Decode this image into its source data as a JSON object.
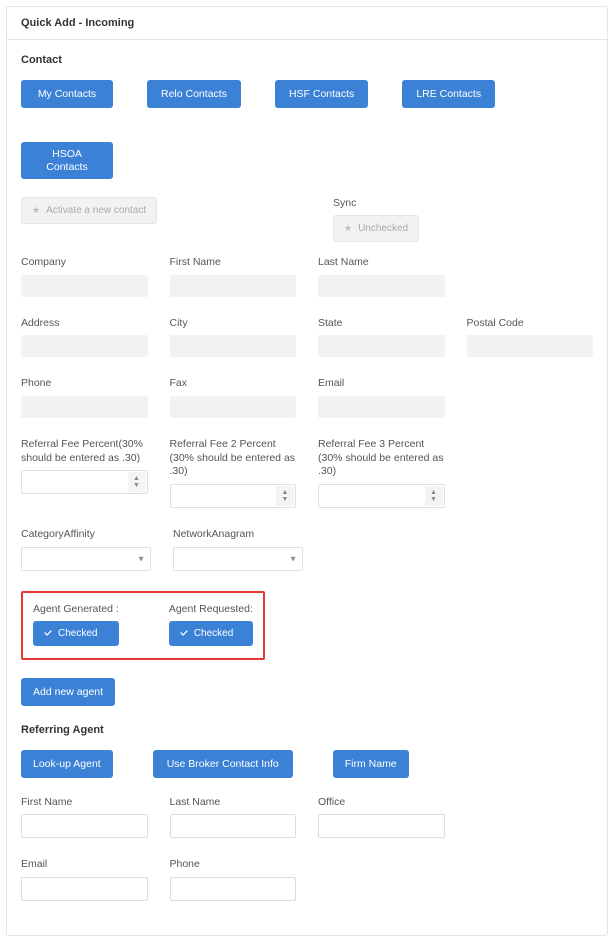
{
  "header": {
    "title": "Quick Add - Incoming"
  },
  "contact": {
    "section_title": "Contact",
    "buttons": {
      "my": "My Contacts",
      "relo": "Relo Contacts",
      "hsf": "HSF Contacts",
      "lre": "LRE Contacts",
      "hsoa": "HSOA Contacts"
    },
    "activate": "Activate a new contact",
    "sync_label": "Sync",
    "sync_button": "Unchecked",
    "fields": {
      "company": "Company",
      "first_name": "First Name",
      "last_name": "Last Name",
      "address": "Address",
      "city": "City",
      "state": "State",
      "postal": "Postal Code",
      "phone": "Phone",
      "fax": "Fax",
      "email": "Email",
      "ref1": "Referral Fee Percent(30% should be entered as .30)",
      "ref2": "Referral Fee 2 Percent (30% should be entered as .30)",
      "ref3": "Referral Fee 3 Percent (30% should be entered as .30)",
      "cat_affinity": "CategoryAffinity",
      "net_anagram": "NetworkAnagram"
    },
    "agent_generated_label": "Agent Generated :",
    "agent_requested_label": "Agent Requested:",
    "checked": "Checked",
    "add_agent": "Add new agent"
  },
  "referring": {
    "section_title": "Referring Agent",
    "buttons": {
      "lookup": "Look-up Agent",
      "broker": "Use Broker Contact Info",
      "firm": "Firm Name"
    },
    "fields": {
      "first_name": "First Name",
      "last_name": "Last Name",
      "office": "Office",
      "email": "Email",
      "phone": "Phone"
    }
  }
}
